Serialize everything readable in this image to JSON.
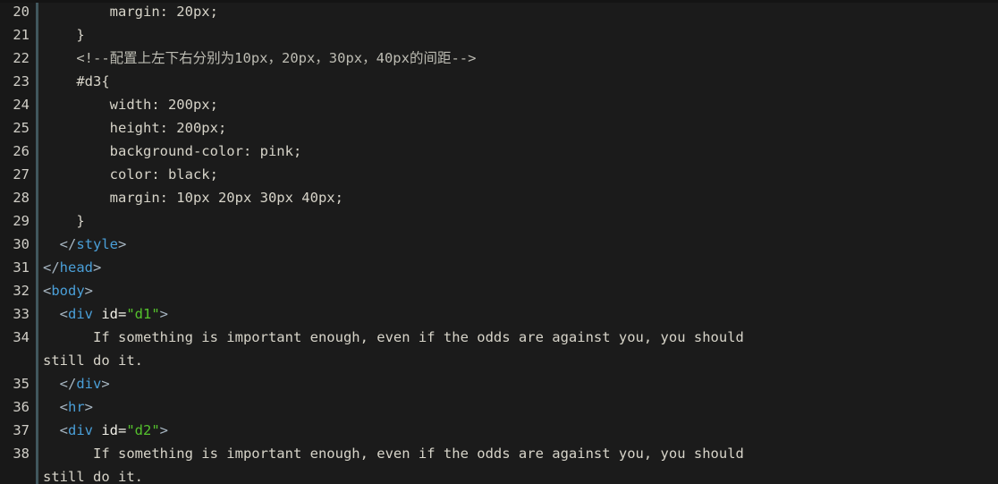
{
  "editor": {
    "background_color": "#1b1b1b",
    "gutter_color": "#181818",
    "gutter_rule_color": "#41575d",
    "line_number_color": "#cfcdc6",
    "default_text_color": "#d7d4c9",
    "tag_color": "#4a9fd8",
    "punct_color": "#a7b6c2",
    "string_color": "#55c22d",
    "attr_color": "#f2f0e8",
    "comment_color": "#bdbcb3",
    "first_visible_line": 20,
    "last_visible_line": 38
  },
  "lines": [
    {
      "n": "20",
      "tokens": [
        {
          "t": "plain",
          "s": "        margin: 20px;"
        }
      ]
    },
    {
      "n": "21",
      "tokens": [
        {
          "t": "plain",
          "s": "    }"
        }
      ]
    },
    {
      "n": "22",
      "tokens": [
        {
          "t": "comment",
          "s": "    <!--配置上左下右分别为10px，20px，30px，40px的间距-->"
        }
      ]
    },
    {
      "n": "23",
      "tokens": [
        {
          "t": "plain",
          "s": "    #d3{"
        }
      ]
    },
    {
      "n": "24",
      "tokens": [
        {
          "t": "plain",
          "s": "        width: 200px;"
        }
      ]
    },
    {
      "n": "25",
      "tokens": [
        {
          "t": "plain",
          "s": "        height: 200px;"
        }
      ]
    },
    {
      "n": "26",
      "tokens": [
        {
          "t": "plain",
          "s": "        background-color: pink;"
        }
      ]
    },
    {
      "n": "27",
      "tokens": [
        {
          "t": "plain",
          "s": "        color: black;"
        }
      ]
    },
    {
      "n": "28",
      "tokens": [
        {
          "t": "plain",
          "s": "        margin: 10px 20px 30px 40px;"
        }
      ]
    },
    {
      "n": "29",
      "tokens": [
        {
          "t": "plain",
          "s": "    }"
        }
      ]
    },
    {
      "n": "30",
      "tokens": [
        {
          "t": "punct",
          "s": "  </"
        },
        {
          "t": "tag",
          "s": "style"
        },
        {
          "t": "punct",
          "s": ">"
        }
      ]
    },
    {
      "n": "31",
      "tokens": [
        {
          "t": "punct",
          "s": "</"
        },
        {
          "t": "tag",
          "s": "head"
        },
        {
          "t": "punct",
          "s": ">"
        }
      ]
    },
    {
      "n": "32",
      "tokens": [
        {
          "t": "punct",
          "s": "<"
        },
        {
          "t": "tag",
          "s": "body"
        },
        {
          "t": "punct",
          "s": ">"
        }
      ]
    },
    {
      "n": "33",
      "tokens": [
        {
          "t": "punct",
          "s": "  <"
        },
        {
          "t": "tag",
          "s": "div"
        },
        {
          "t": "plain",
          "s": " "
        },
        {
          "t": "attr",
          "s": "id="
        },
        {
          "t": "string",
          "s": "\"d1\""
        },
        {
          "t": "punct",
          "s": ">"
        }
      ]
    },
    {
      "n": "34",
      "tokens": [
        {
          "t": "plain",
          "s": "      If something is important enough, even if the odds are against you, you should"
        }
      ],
      "wrap": [
        {
          "tokens": [
            {
              "t": "plain",
              "s": "still do it."
            }
          ]
        }
      ]
    },
    {
      "n": "35",
      "tokens": [
        {
          "t": "punct",
          "s": "  </"
        },
        {
          "t": "tag",
          "s": "div"
        },
        {
          "t": "punct",
          "s": ">"
        }
      ]
    },
    {
      "n": "36",
      "tokens": [
        {
          "t": "punct",
          "s": "  <"
        },
        {
          "t": "tag",
          "s": "hr"
        },
        {
          "t": "punct",
          "s": ">"
        }
      ]
    },
    {
      "n": "37",
      "tokens": [
        {
          "t": "punct",
          "s": "  <"
        },
        {
          "t": "tag",
          "s": "div"
        },
        {
          "t": "plain",
          "s": " "
        },
        {
          "t": "attr",
          "s": "id="
        },
        {
          "t": "string",
          "s": "\"d2\""
        },
        {
          "t": "punct",
          "s": ">"
        }
      ]
    },
    {
      "n": "38",
      "tokens": [
        {
          "t": "plain",
          "s": "      If something is important enough, even if the odds are against you, you should"
        }
      ],
      "wrap": [
        {
          "tokens": [
            {
              "t": "plain",
              "s": "still do it."
            }
          ]
        }
      ]
    }
  ]
}
